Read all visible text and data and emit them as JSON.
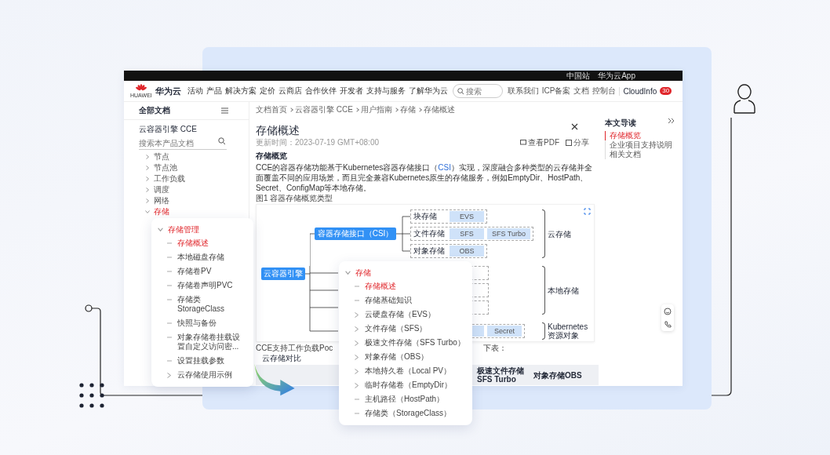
{
  "browser": {
    "top_links": [
      "中国站",
      "华为云App"
    ]
  },
  "nav": {
    "logo_text": "华为云",
    "logo_sub": "HUAWEI",
    "items": [
      "活动",
      "产品",
      "解决方案",
      "定价",
      "云商店",
      "合作伙伴",
      "开发者",
      "支持与服务",
      "了解华为云"
    ],
    "search": {
      "placeholder": "搜索"
    },
    "right_links": [
      "联系我们",
      "ICP备案",
      "文档",
      "控制台"
    ],
    "user": "CloudInfo",
    "badge": "30"
  },
  "sidebar": {
    "title": "全部文档",
    "product": "云容器引擎 CCE",
    "search": {
      "placeholder": "搜索本产品文档"
    },
    "items": [
      {
        "label": "节点",
        "expanded": false,
        "selected": false
      },
      {
        "label": "节点池",
        "expanded": false,
        "selected": false
      },
      {
        "label": "工作负载",
        "expanded": false,
        "selected": false
      },
      {
        "label": "调度",
        "expanded": false,
        "selected": false
      },
      {
        "label": "网络",
        "expanded": false,
        "selected": false
      },
      {
        "label": "存储",
        "expanded": true,
        "selected": true
      }
    ]
  },
  "breadcrumb": [
    "文档首页",
    "云容器引擎 CCE",
    "用户指南",
    "存储",
    "存储概述"
  ],
  "article": {
    "title": "存储概述",
    "updated": "更新时间：2023-07-19 GMT+08:00",
    "actions": [
      "查看PDF",
      "分享"
    ],
    "section": "存储概览",
    "paragraph": {
      "before": "CCE的容器存储功能基于Kubernetes容器存储接口（",
      "link": "CSI",
      "after": "）实现，深度融合多种类型的云存储并全面覆盖不同的应用场景，而且完全兼容Kubernetes原生的存储服务，例如EmptyDir、HostPath、Secret、ConfigMap等本地存储。"
    },
    "figure_caption": "图1 容器存储概览类型",
    "diagram": {
      "root": "云容器引擎",
      "interface": "容器存储接口（CSI）",
      "groups": [
        {
          "label": "块存储",
          "items": [
            "EVS"
          ]
        },
        {
          "label": "文件存储",
          "items": [
            "SFS",
            "SFS Turbo"
          ]
        },
        {
          "label": "对象存储",
          "items": [
            "OBS"
          ]
        }
      ],
      "k8s_items": [
        "Secret"
      ],
      "braces": [
        "云存储",
        "本地存储",
        "Kubernetes资源对象"
      ]
    },
    "after_text": [
      "CCE支持工作负载Poc",
      "下表："
    ],
    "subheading": "云存储对比",
    "table_headers": [
      "极速文件存储SFS Turbo",
      "对象存储OBS"
    ]
  },
  "toc": {
    "title": "本文导读",
    "items": [
      {
        "label": "存储概览",
        "selected": true
      },
      {
        "label": "企业项目支持说明",
        "selected": false
      },
      {
        "label": "相关文档",
        "selected": false
      }
    ]
  },
  "popup_left": {
    "heading": "存储管理",
    "expanded": true,
    "items": [
      {
        "label": "存储概述",
        "kind": "leaf",
        "selected": true
      },
      {
        "label": "本地磁盘存储",
        "kind": "leaf",
        "selected": false
      },
      {
        "label": "存储卷PV",
        "kind": "leaf",
        "selected": false
      },
      {
        "label": "存储卷声明PVC",
        "kind": "leaf",
        "selected": false
      },
      {
        "label": "存储类StorageClass",
        "kind": "leaf",
        "selected": false
      },
      {
        "label": "快照与备份",
        "kind": "leaf",
        "selected": false
      },
      {
        "label": "对象存储卷挂载设置自定义访问密...",
        "kind": "leaf",
        "selected": false
      },
      {
        "label": "设置挂载参数",
        "kind": "leaf",
        "selected": false
      },
      {
        "label": "云存储使用示例",
        "kind": "branch",
        "selected": false
      }
    ]
  },
  "popup_right": {
    "heading": "存储",
    "expanded": true,
    "items": [
      {
        "label": "存储概述",
        "kind": "leaf",
        "selected": true
      },
      {
        "label": "存储基础知识",
        "kind": "leaf",
        "selected": false
      },
      {
        "label": "云硬盘存储（EVS）",
        "kind": "branch",
        "selected": false
      },
      {
        "label": "文件存储（SFS）",
        "kind": "branch",
        "selected": false
      },
      {
        "label": "极速文件存储（SFS Turbo）",
        "kind": "branch",
        "selected": false
      },
      {
        "label": "对象存储（OBS）",
        "kind": "branch",
        "selected": false
      },
      {
        "label": "本地持久卷（Local PV）",
        "kind": "branch",
        "selected": false
      },
      {
        "label": "临时存储卷（EmptyDir）",
        "kind": "branch",
        "selected": false
      },
      {
        "label": "主机路径（HostPath）",
        "kind": "leaf",
        "selected": false
      },
      {
        "label": "存储类（StorageClass）",
        "kind": "leaf",
        "selected": false
      }
    ]
  }
}
